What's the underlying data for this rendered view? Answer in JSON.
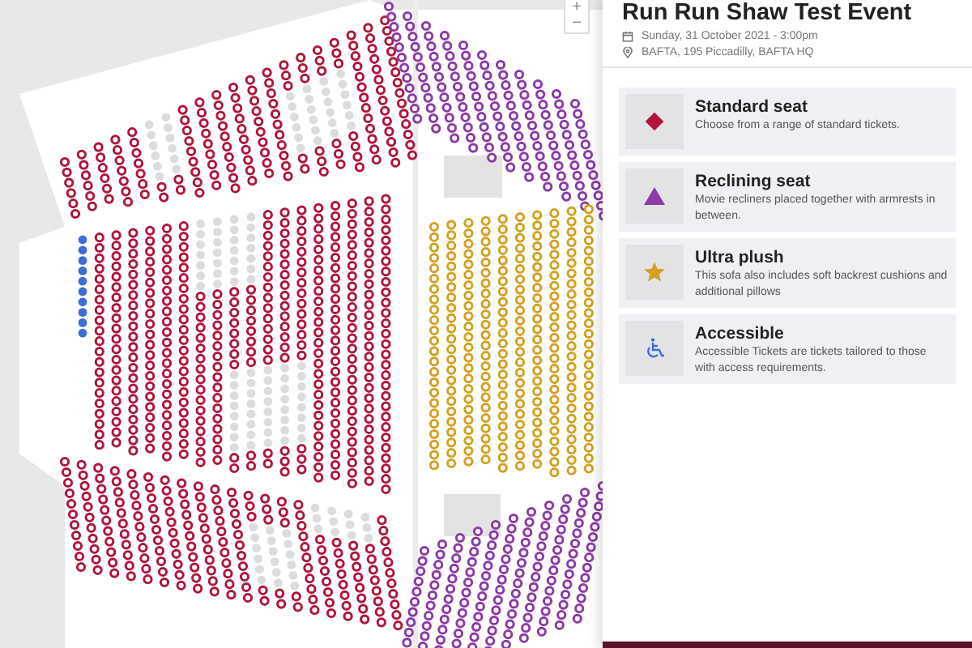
{
  "map": {
    "zoom_controls": [
      "+",
      "−"
    ],
    "seat_blocks": [
      {
        "kind": "standard"
      },
      {
        "kind": "unavailable"
      },
      {
        "kind": "unavailable"
      },
      {
        "kind": "accessible"
      },
      {
        "kind": "standard"
      },
      {
        "kind": "unavailable"
      },
      {
        "kind": "unavailable"
      },
      {
        "kind": "standard"
      },
      {
        "kind": "unavailable"
      },
      {
        "kind": "unavailable"
      },
      {
        "kind": "recliner"
      },
      {
        "kind": "plush"
      },
      {
        "kind": "recliner"
      }
    ]
  },
  "event": {
    "title": "Run Run Shaw Test Event",
    "date": "Sunday, 31 October 2021 - 3:00pm",
    "venue": "BAFTA, 195 Piccadilly, BAFTA HQ"
  },
  "legend": [
    {
      "kind": "standard",
      "title": "Standard seat",
      "description": "Choose from a range of standard tickets."
    },
    {
      "kind": "recliner",
      "title": "Reclining seat",
      "description": "Movie recliners placed together with armrests in between."
    },
    {
      "kind": "plush",
      "title": "Ultra plush",
      "description": "This sofa also includes soft backrest cushions and additional pillows"
    },
    {
      "kind": "accessible",
      "title": "Accessible",
      "description": "Accessible Tickets are tickets tailored to those with access requirements."
    }
  ]
}
